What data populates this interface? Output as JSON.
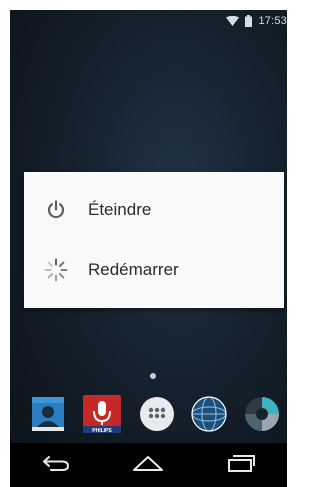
{
  "status_bar": {
    "time": "17:53",
    "icons": [
      "wifi-icon",
      "battery-icon"
    ]
  },
  "power_menu": {
    "items": [
      {
        "label": "Éteindre",
        "icon": "power-icon"
      },
      {
        "label": "Redémarrer",
        "icon": "restart-icon"
      }
    ]
  },
  "home_screen": {
    "page_indicator": {
      "current": 1,
      "total": 1
    },
    "dock": [
      {
        "icon": "contacts-icon"
      },
      {
        "icon": "voice-recorder-icon",
        "brand": "PHILIPS"
      },
      {
        "icon": "app-drawer-icon"
      },
      {
        "icon": "globe-icon"
      },
      {
        "icon": "photos-icon"
      }
    ]
  },
  "navigation_bar": {
    "buttons": [
      "back-icon",
      "home-icon",
      "recents-icon"
    ]
  },
  "colors": {
    "dialog_background": "#fafafa",
    "wallpaper_dark": "#0b1118",
    "wallpaper_light": "#223447",
    "recorder_red": "#c62828",
    "contacts_blue": "#2b7fc0"
  }
}
